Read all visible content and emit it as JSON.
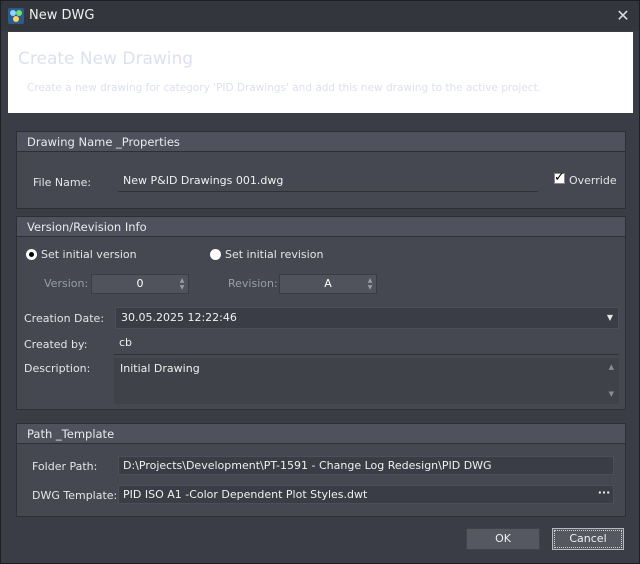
{
  "window": {
    "title": "New DWG",
    "close_glyph": "✕"
  },
  "banner": {
    "title": "Create New Drawing",
    "subtitle": "Create a new drawing for category 'PID Drawings' and add this new drawing to the active project."
  },
  "drawing_name": {
    "group_title": "Drawing Name _Properties",
    "file_name_label": "File Name:",
    "file_name_value": "New P&ID Drawings 001.dwg",
    "override_label": "Override",
    "override_checked": true
  },
  "version": {
    "group_title": "Version/Revision Info",
    "radio_version_label": "Set initial version",
    "radio_revision_label": "Set initial revision",
    "selected": "version",
    "version_label": "Version:",
    "version_value": "0",
    "revision_label": "Revision:",
    "revision_value": "A",
    "creation_date_label": "Creation Date:",
    "creation_date_value": "30.05.2025 12:22:46",
    "created_by_label": "Created by:",
    "created_by_value": "cb",
    "description_label": "Description:",
    "description_value": "Initial Drawing"
  },
  "path": {
    "group_title": "Path _Template",
    "folder_label": "Folder Path:",
    "folder_value": "D:\\Projects\\Development\\PT-1591 - Change Log Redesign\\PID DWG",
    "template_label": "DWG Template:",
    "template_value": "PID ISO A1 -Color Dependent Plot Styles.dwt",
    "browse_glyph": "···"
  },
  "buttons": {
    "ok": "OK",
    "cancel": "Cancel"
  },
  "icons": {
    "app": "dwg-app-icon",
    "close": "close-icon",
    "dropdown": "chevron-down-icon",
    "spin": "spin-arrows-icon",
    "browse": "ellipsis-icon"
  }
}
